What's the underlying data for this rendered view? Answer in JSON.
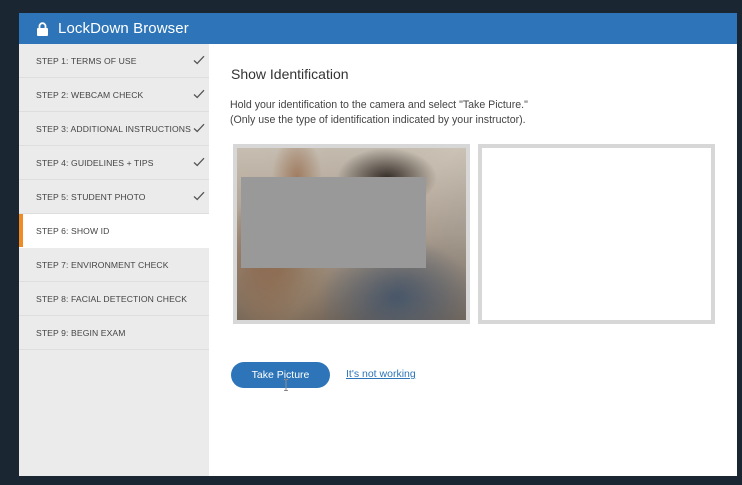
{
  "app": {
    "title": "LockDown Browser",
    "icon": "lock-icon"
  },
  "sidebar": {
    "steps": [
      {
        "label": "STEP 1: TERMS OF USE",
        "completed": true
      },
      {
        "label": "STEP 2: WEBCAM CHECK",
        "completed": true
      },
      {
        "label": "STEP 3: ADDITIONAL INSTRUCTIONS",
        "completed": true
      },
      {
        "label": "STEP 4: GUIDELINES + TIPS",
        "completed": true
      },
      {
        "label": "STEP 5: STUDENT PHOTO",
        "completed": true
      },
      {
        "label": "STEP 6: SHOW ID",
        "completed": false,
        "active": true
      },
      {
        "label": "STEP 7: ENVIRONMENT CHECK",
        "completed": false
      },
      {
        "label": "STEP 8: FACIAL DETECTION CHECK",
        "completed": false
      },
      {
        "label": "STEP 9: BEGIN EXAM",
        "completed": false
      }
    ]
  },
  "main": {
    "heading": "Show Identification",
    "instructions_line1": "Hold your identification to the camera and select \"Take Picture.\"",
    "instructions_line2": "(Only use the type of identification indicated by your instructor).",
    "take_picture_label": "Take Picture",
    "not_working_label": "It's not working"
  },
  "colors": {
    "titlebar": "#2d75b8",
    "active_step_accent": "#f08a24",
    "button": "#2d75b8",
    "link": "#2d75b8"
  }
}
